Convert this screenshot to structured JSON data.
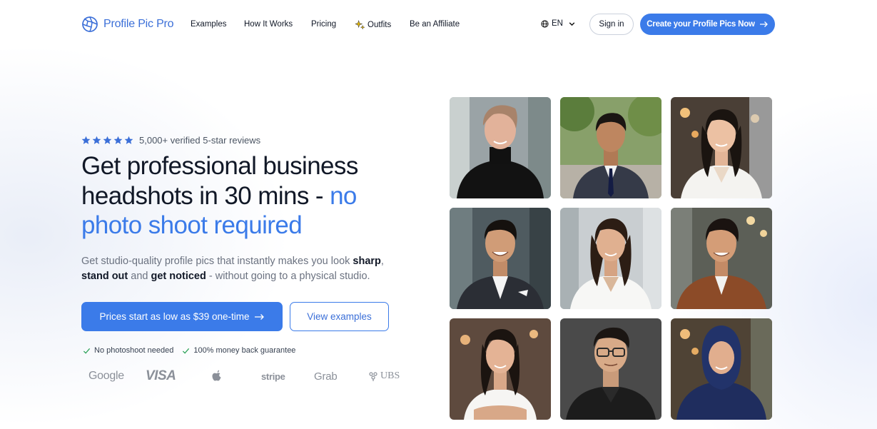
{
  "brand": {
    "name": "Profile Pic Pro",
    "accent": "#3b7be9"
  },
  "nav": {
    "links": [
      {
        "label": "Examples"
      },
      {
        "label": "How It Works"
      },
      {
        "label": "Pricing"
      },
      {
        "label": "Outfits",
        "icon": "sparkle-icon"
      },
      {
        "label": "Be an Affiliate"
      }
    ],
    "language": {
      "label": "EN",
      "icon": "globe-icon"
    },
    "signin_label": "Sign in",
    "cta_label": "Create your Profile Pics Now"
  },
  "hero": {
    "rating": {
      "stars": 5,
      "text": "5,000+ verified 5-star reviews"
    },
    "headline_dark": "Get professional business headshots in 30 mins - ",
    "headline_blue": "no photo shoot required",
    "subcopy": {
      "part1": "Get studio-quality profile pics that instantly makes you look ",
      "bold1": "sharp",
      "part2": ", ",
      "bold2": "stand out",
      "part3": " and ",
      "bold3": "get noticed",
      "part4": " - without going to a physical studio."
    },
    "primary_button": "Prices start as low as $39 one-time",
    "secondary_button": "View examples",
    "checks": [
      "No photoshoot needed",
      "100% money back guarantee"
    ],
    "brand_logos": [
      "Google",
      "VISA",
      "apple-logo",
      "stripe",
      "Grab",
      "UBS"
    ]
  },
  "photo_grid": {
    "photos": [
      "portrait-woman-short-hair-black-turtleneck",
      "portrait-man-navy-suit-outdoors",
      "portrait-woman-white-blazer-cafe",
      "portrait-man-dark-suit-office",
      "portrait-woman-white-blazer-office",
      "portrait-man-brown-leather-jacket",
      "portrait-woman-white-top-arms-crossed",
      "portrait-man-glasses-leather-jacket",
      "portrait-woman-navy-hijab"
    ]
  }
}
